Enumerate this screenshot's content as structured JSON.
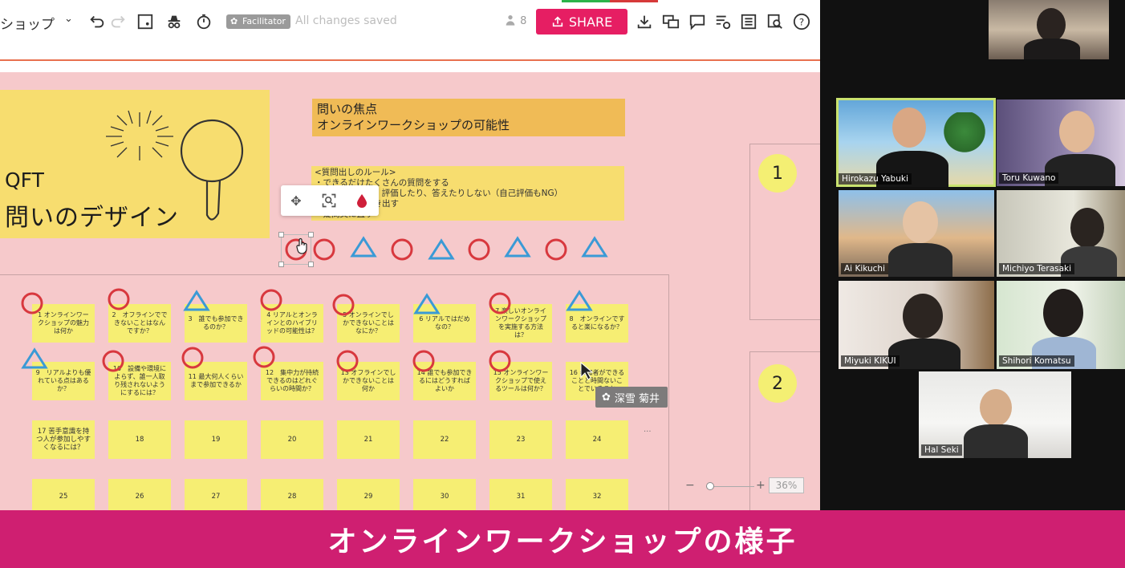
{
  "toolbar": {
    "board_name": "ショップ",
    "facilitator_badge": "Facilitator",
    "save_status": "All changes saved",
    "participant_count": "8",
    "share_label": "SHARE"
  },
  "canvas": {
    "title_card": {
      "line1": "QFT",
      "line2": "問いのデザイン"
    },
    "focus_note": {
      "line1": "問いの焦点",
      "line2": "オンラインワークショップの可能性"
    },
    "rules_note": {
      "lines": [
        "<質問出しのルール>",
        "・できるだけたくさんの質問をする",
        "・話し合ったり、評価したり、答えたりしない（自己評価もNG）",
        "・質問通りに書き出す",
        "・疑問文に直す"
      ]
    },
    "stickies_row1": [
      "1 オンラインワークショップの魅力は何か",
      "2　オフラインでできないことはなんですか？",
      "3　誰でも参加できるのか？",
      "4 リアルとオンラインとのハイブリッドの可能性は？",
      "5 オンラインでしかできないことはなにか？",
      "6 リアルではだめなの？",
      "7 楽しいオンラインワークショップを実施する方法は？",
      "8　オンラインですると楽になるか？"
    ],
    "stickies_row2": [
      "9　リアルよりも優れている点はあるか？",
      "10　設備や環境によらず、誰一人取り残されないようにするには？",
      "11 最大何人くらいまで参加できるか",
      "12　集中力が持続できるのはどれぐらいの時間か？",
      "13 オフラインでしかできないことは何か",
      "14 誰でも参加できるにはどうすればよいか",
      "15 オンラインワークショップで使えるツールは何か？",
      "16 参加者ができることと時間ないことでいること"
    ],
    "stickies_row3": [
      "17 苦手意識を持つ人が参加しやすくなるには？",
      "18",
      "19",
      "20",
      "21",
      "22",
      "23",
      "24"
    ],
    "stickies_row4": [
      "25",
      "26",
      "27",
      "28",
      "29",
      "30",
      "31",
      "32"
    ],
    "section_numbers": [
      "1",
      "2"
    ],
    "user_cursor_label": "深雪 菊井",
    "zoom": {
      "minus": "−",
      "plus": "+",
      "percent": "36%"
    },
    "ellipsis": "..."
  },
  "video": {
    "participants": [
      {
        "name": "Hirokazu Yabuki"
      },
      {
        "name": "Toru Kuwano"
      },
      {
        "name": "Ai Kikuchi"
      },
      {
        "name": "Michiyo Terasaki"
      },
      {
        "name": "Miyuki KIKUI"
      },
      {
        "name": "Shihori Komatsu"
      },
      {
        "name": "Hal Seki"
      }
    ]
  },
  "caption": "オンラインワークショップの様子",
  "colors": {
    "share": "#e61e63",
    "caption_bg": "#cf1f71",
    "canvas_bg": "#f6c9cb",
    "sticky": "#f6ee73",
    "circle_mark": "#d8383e",
    "triangle_mark": "#3a9ad6"
  }
}
